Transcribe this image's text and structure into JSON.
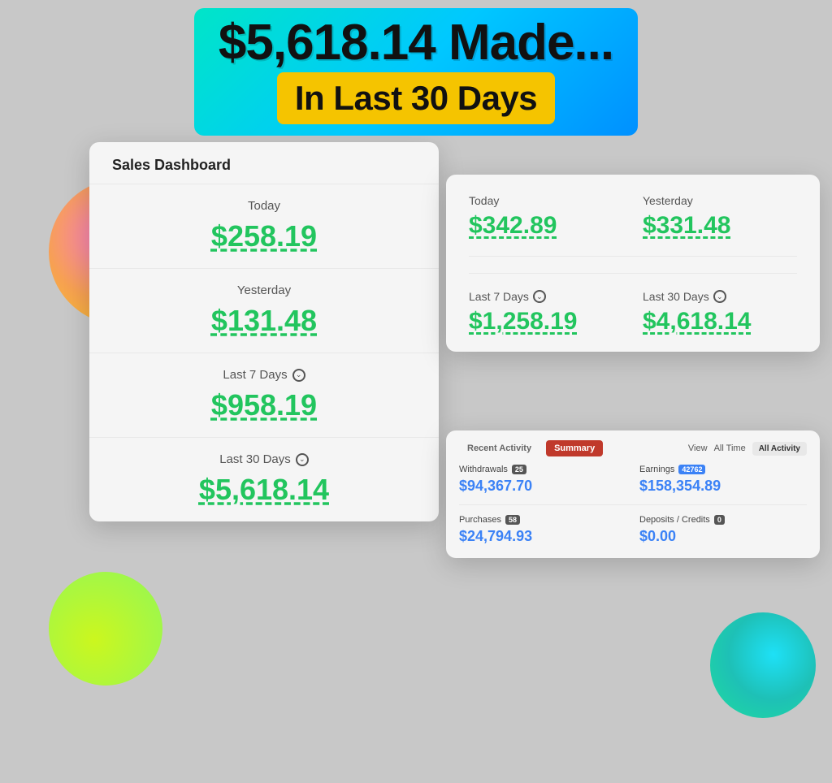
{
  "header": {
    "title": "$5,618.14 Made...",
    "subtitle": "In Last 30 Days"
  },
  "sales_dashboard": {
    "title": "Sales Dashboard",
    "metrics": [
      {
        "label": "Today",
        "value": "$258.19",
        "hasChevron": false
      },
      {
        "label": "Yesterday",
        "value": "$131.48",
        "hasChevron": false
      },
      {
        "label": "Last 7 Days",
        "value": "$958.19",
        "hasChevron": true
      },
      {
        "label": "Last 30 Days",
        "value": "$5,618.14",
        "hasChevron": true
      }
    ]
  },
  "stats_card": {
    "today_label": "Today",
    "today_value": "$342.89",
    "yesterday_label": "Yesterday",
    "yesterday_value": "$331.48",
    "last7_label": "Last 7 Days",
    "last7_value": "$1,258.19",
    "last30_label": "Last 30 Days",
    "last30_value": "$4,618.14"
  },
  "activity_card": {
    "tab_recent": "Recent Activity",
    "tab_summary": "Summary",
    "view_label": "View",
    "view_value": "All Time",
    "all_activity_btn": "All Activity",
    "withdrawals_label": "Withdrawals",
    "withdrawals_badge": "25",
    "withdrawals_value": "$94,367.70",
    "earnings_label": "Earnings",
    "earnings_badge": "42762",
    "earnings_value": "$158,354.89",
    "purchases_label": "Purchases",
    "purchases_badge": "58",
    "purchases_value": "$24,794.93",
    "deposits_label": "Deposits / Credits",
    "deposits_badge": "0",
    "deposits_value": "$0.00"
  }
}
